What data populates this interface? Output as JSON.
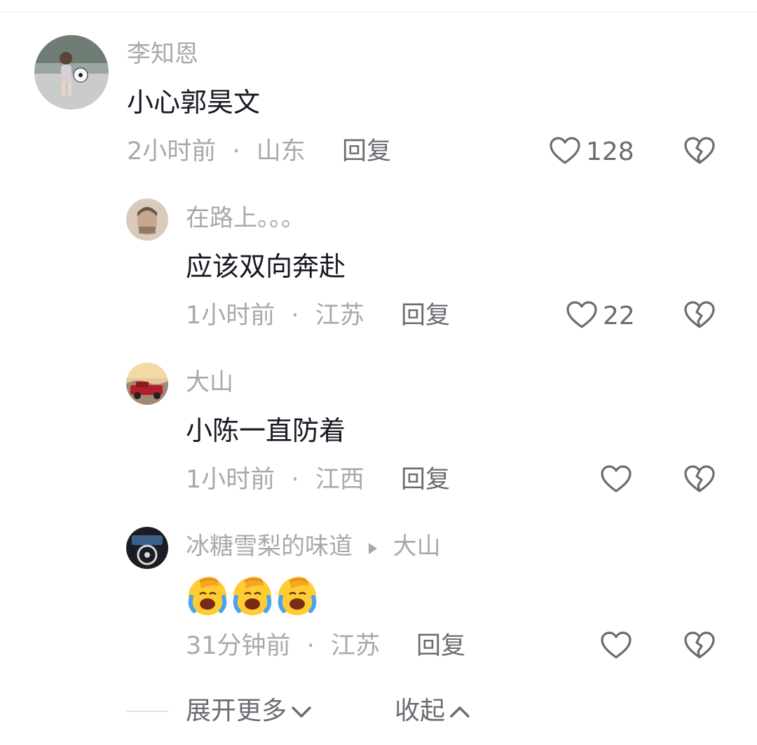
{
  "comments": [
    {
      "username": "李知恩",
      "content": "小心郭昊文",
      "time": "2小时前",
      "location": "山东",
      "reply_label": "回复",
      "likes": "128",
      "avatar_icon": "boy-with-soccer-ball-avatar"
    },
    {
      "username": "在路上。。。",
      "content": "应该双向奔赴",
      "time": "1小时前",
      "location": "江苏",
      "reply_label": "回复",
      "likes": "22",
      "avatar_icon": "man-portrait-avatar"
    },
    {
      "username": "大山",
      "content": "小陈一直防着",
      "time": "1小时前",
      "location": "江西",
      "reply_label": "回复",
      "likes": "",
      "avatar_icon": "red-truck-avatar"
    },
    {
      "username": "冰糖雪梨的味道",
      "reply_to": "大山",
      "content_emojis": [
        "facepalm-crying-emoji",
        "facepalm-crying-emoji",
        "facepalm-crying-emoji"
      ],
      "time": "31分钟前",
      "location": "江苏",
      "reply_label": "回复",
      "likes": "",
      "avatar_icon": "car-dashboard-avatar"
    }
  ],
  "separator": "·",
  "footer": {
    "expand_label": "展开更多",
    "collapse_label": "收起"
  },
  "colors": {
    "text_primary": "#161823",
    "text_secondary": "#a8a8ae",
    "action_grey": "#6b6b72"
  }
}
